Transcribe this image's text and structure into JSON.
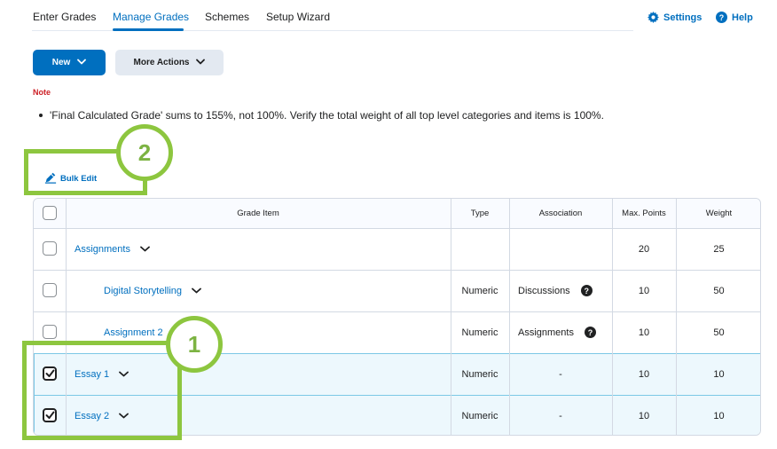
{
  "nav": {
    "tabs": [
      {
        "label": "Enter Grades",
        "active": false
      },
      {
        "label": "Manage Grades",
        "active": true
      },
      {
        "label": "Schemes",
        "active": false
      },
      {
        "label": "Setup Wizard",
        "active": false
      }
    ],
    "settings_label": "Settings",
    "help_label": "Help"
  },
  "toolbar": {
    "new_label": "New",
    "more_actions_label": "More Actions"
  },
  "note": {
    "label": "Note",
    "items": [
      "'Final Calculated Grade' sums to 155%, not 100%. Verify the total weight of all top level categories and items is 100%."
    ]
  },
  "bulk_edit_label": "Bulk Edit",
  "table": {
    "headers": {
      "grade_item": "Grade Item",
      "type": "Type",
      "association": "Association",
      "max_points": "Max. Points",
      "weight": "Weight"
    },
    "rows": [
      {
        "name": "Assignments",
        "type": "",
        "association": "",
        "max_points": "20",
        "weight": "25",
        "indent": false,
        "checked": false,
        "has_help": false
      },
      {
        "name": "Digital Storytelling",
        "type": "Numeric",
        "association": "Discussions",
        "max_points": "10",
        "weight": "50",
        "indent": true,
        "checked": false,
        "has_help": true
      },
      {
        "name": "Assignment 2",
        "type": "Numeric",
        "association": "Assignments",
        "max_points": "10",
        "weight": "50",
        "indent": true,
        "checked": false,
        "has_help": true
      },
      {
        "name": "Essay 1",
        "type": "Numeric",
        "association": "-",
        "max_points": "10",
        "weight": "10",
        "indent": false,
        "checked": true,
        "has_help": false
      },
      {
        "name": "Essay 2",
        "type": "Numeric",
        "association": "-",
        "max_points": "10",
        "weight": "10",
        "indent": false,
        "checked": true,
        "has_help": false
      }
    ]
  },
  "callouts": {
    "one": "1",
    "two": "2"
  },
  "colors": {
    "accent": "#006fbf",
    "note_red": "#cd2026",
    "callout_green": "#8dc63f",
    "selected_row": "#edf8fd"
  }
}
